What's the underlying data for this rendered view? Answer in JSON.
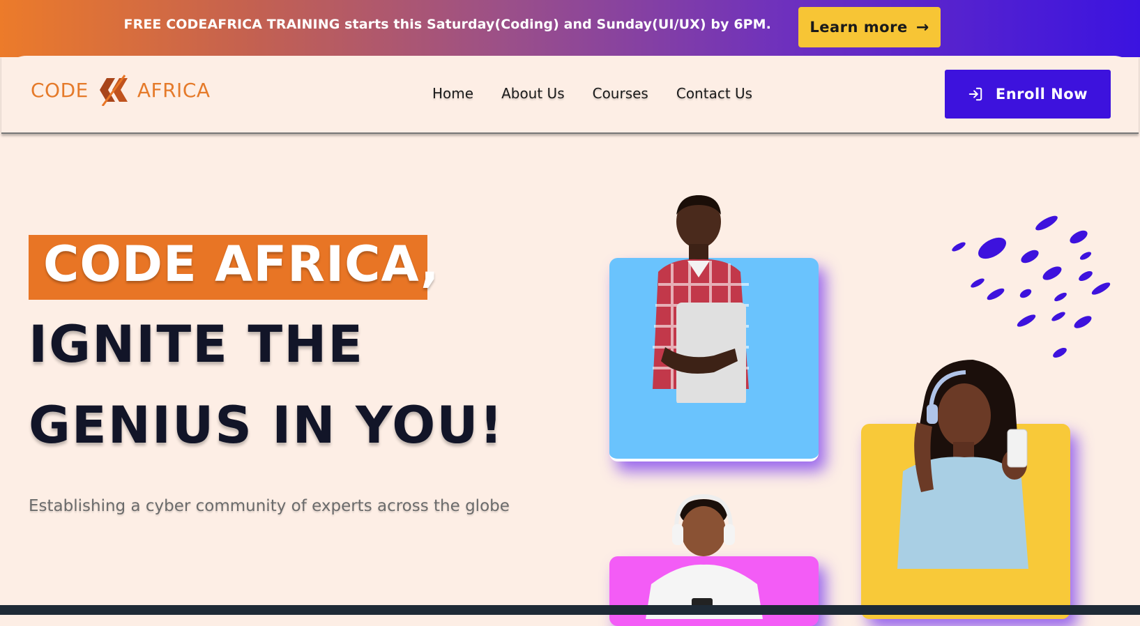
{
  "announcement": {
    "text": "FREE CODEAFRICA TRAINING starts this Saturday(Coding) and Sunday(UI/UX) by 6PM.",
    "button_label": "Learn more",
    "button_icon": "arrow-right-icon"
  },
  "header": {
    "logo_left": "CODE",
    "logo_right": "AFRICA",
    "nav": [
      "Home",
      "About Us",
      "Courses",
      "Contact Us"
    ],
    "cta_label": "Enroll Now",
    "cta_icon": "login-arrow-icon"
  },
  "hero": {
    "line1": "CODE AFRICA,",
    "line2": "IGNITE THE",
    "line3": "GENIUS IN YOU!",
    "subtitle": "Establishing a cyber community of experts across the globe"
  },
  "colors": {
    "brand_orange": "#e87525",
    "brand_purple": "#3d12dd",
    "accent_yellow": "#f7c535",
    "card_blue": "#6ac3fd",
    "card_yellow": "#f8c939",
    "card_pink": "#f35cf6",
    "background": "#fdeee5"
  }
}
